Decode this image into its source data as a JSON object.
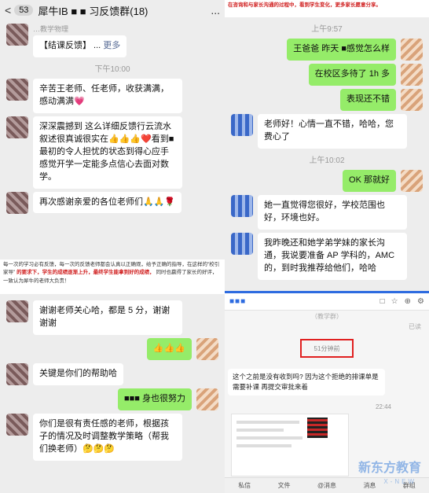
{
  "panel1": {
    "back_label": "<",
    "unread": "53",
    "title": "犀牛IB ■ ■ 习反馈群(18)",
    "more_icon": "...",
    "msgs": {
      "m1": {
        "nick": "…教学物理",
        "text": "【结课反馈】 ...",
        "more": "更多"
      },
      "time1": "下午10:00",
      "m2": {
        "text": "辛苦王老师、任老师，收获满满，感动满满💗"
      },
      "m3": {
        "text": "深深震撼到 这么详细反馈行云流水叙述很真诚很实在👍👍👍❤️看到■ 最初的令人担忧的状态到得心应手感觉开学一定能多点信心去面对数学。"
      },
      "m4": {
        "text": "再次感谢亲爱的各位老师们🙏🙏🌹"
      }
    }
  },
  "panel2": {
    "banner": "在咨询和与家长沟通的过程中，看到学生变化，更多家长愿意分享。",
    "time1": "上午9:57",
    "m1": "王爸爸 昨天 ■感觉怎么样",
    "m2": "在校区多待了 1h 多",
    "m3": "表现还不错",
    "m4": "老师好！心情一直不错，哈哈，您费心了",
    "time2": "上午10:02",
    "m5": "OK 那就好",
    "m6": "她一直觉得您很好，学校范围也好，环境也好。",
    "m7": "我昨晚还和她学弟学妹的家长沟通，我说要准备 AP 学科的，AMC 的，到时我推荐给他们，哈哈"
  },
  "panel3": {
    "banner_line1": "每一次的学习必有反馈，每一次的反馈老师都会认真以正确观，给予正确的指导，在这样的\"校引家导\"",
    "banner_red": "的要求下，学生的成绩逐渐上升，最终学生能拿到好的成绩，",
    "banner_line2": "同时也赢得了家长的好评，一致认为犀牛的老师大负责！",
    "m1": "谢谢老师关心哈，都是 5 分，谢谢谢谢",
    "m2": "👍👍👍",
    "m3": "关键是你们的帮助哈",
    "m4": "■■■ 身也很努力",
    "m5": "你们是很有责任感的老师，根据孩子的情况及时调整教学策略（帮我们换老师）🤔🤔🤔"
  },
  "panel4": {
    "toolbar_dots": "■■■",
    "toolbar_icons": [
      "□",
      "☆",
      "⊕",
      "⚙"
    ],
    "status": "已读",
    "duration": "51分钟前",
    "group_label": "（教学群）",
    "msg": "这个之前是没有收到吗? 因为这个拒绝的排课单是需要补课 再提交审批来着",
    "msg_time": "22:44",
    "bottom_items": [
      "私信",
      "文件",
      "@消息",
      "消息",
      "群组"
    ],
    "watermark": "新东方教育",
    "watermark_sub": "X-NEW"
  }
}
